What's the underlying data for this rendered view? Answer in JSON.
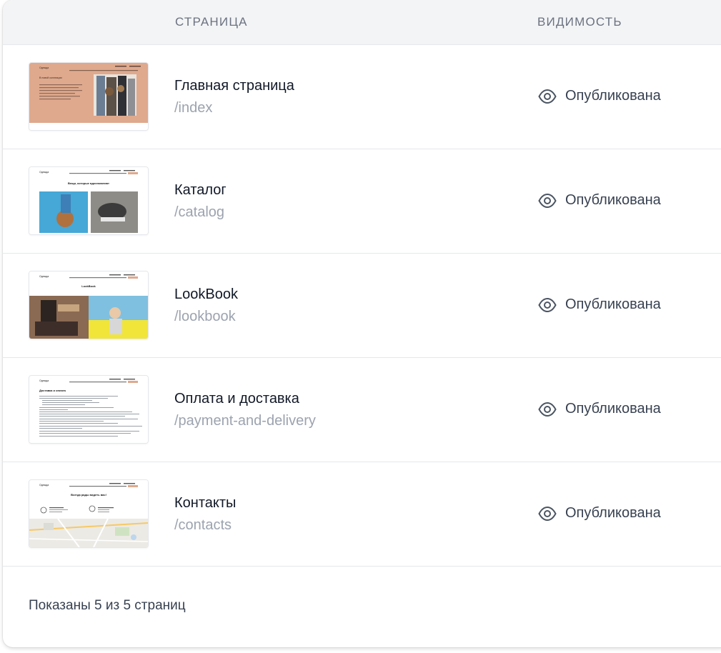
{
  "table": {
    "col_page": "СТРАНИЦА",
    "col_visibility": "ВИДИМОСТЬ"
  },
  "rows": [
    {
      "title": "Главная страница",
      "slug": "/index",
      "status": "Опубликована",
      "thumb_icon": "home-page-preview",
      "thumb_text": [
        "Одежда",
        "В новой коллекции"
      ]
    },
    {
      "title": "Каталог",
      "slug": "/catalog",
      "status": "Опубликована",
      "thumb_icon": "catalog-page-preview",
      "thumb_text": [
        "Одежда",
        "Вещи, которые вдохновляют"
      ]
    },
    {
      "title": "LookBook",
      "slug": "/lookbook",
      "status": "Опубликована",
      "thumb_icon": "lookbook-page-preview",
      "thumb_text": [
        "Одежда",
        "LookBook"
      ]
    },
    {
      "title": "Оплата и доставка",
      "slug": "/payment-and-delivery",
      "status": "Опубликована",
      "thumb_icon": "delivery-page-preview",
      "thumb_text": [
        "Одежда",
        "Доставка и оплата"
      ]
    },
    {
      "title": "Контакты",
      "slug": "/contacts",
      "status": "Опубликована",
      "thumb_icon": "contacts-page-preview",
      "thumb_text": [
        "Одежда",
        "Всегда рады видеть вас!"
      ]
    }
  ],
  "footer": {
    "summary": "Показаны 5 из 5 страниц"
  },
  "colors": {
    "header_bg": "#f3f4f6",
    "accent_peach": "#dfa98d",
    "text_primary": "#111827",
    "text_muted": "#9ca3af"
  },
  "icons": {
    "status": "eye-icon"
  }
}
